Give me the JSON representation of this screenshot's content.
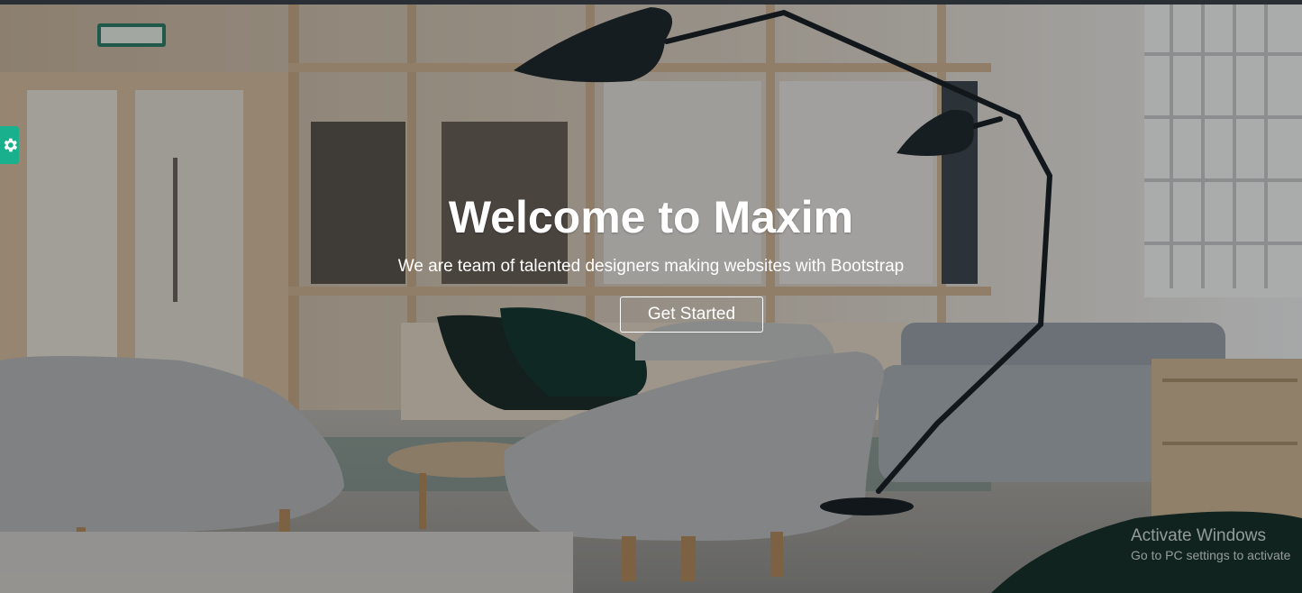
{
  "hero": {
    "title": "Welcome to Maxim",
    "subtitle": "We are team of talented designers making websites with Bootstrap",
    "cta_label": "Get Started"
  },
  "settings": {
    "icon": "gear-icon",
    "accent": "#19b08e"
  },
  "watermark": {
    "title": "Activate Windows",
    "subtitle": "Go to PC settings to activate"
  },
  "colors": {
    "accent": "#19b08e",
    "text": "#ffffff"
  }
}
